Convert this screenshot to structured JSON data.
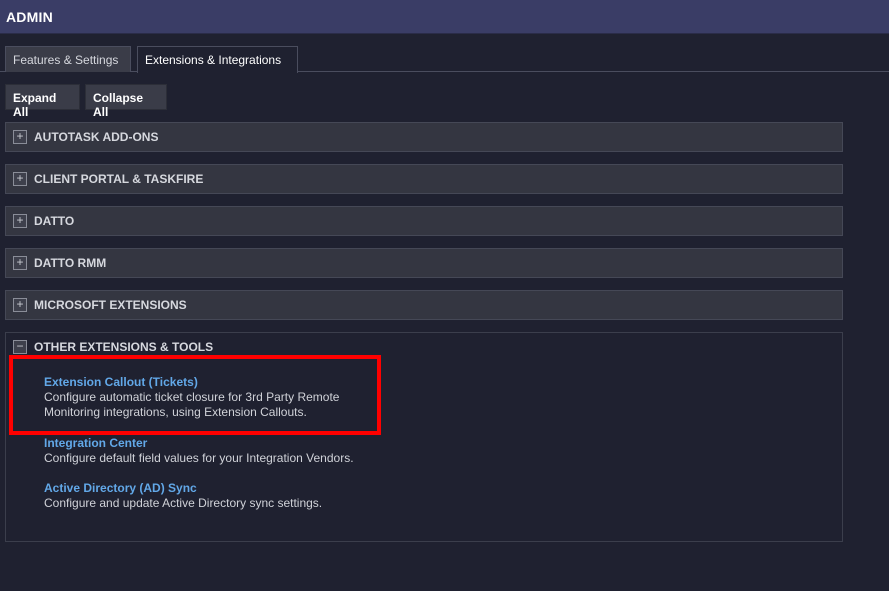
{
  "header": {
    "title": "ADMIN"
  },
  "tabs": [
    {
      "label": "Features & Settings",
      "active": false
    },
    {
      "label": "Extensions & Integrations",
      "active": true
    }
  ],
  "toolbar": {
    "expand_label": "Expand All",
    "collapse_label": "Collapse All"
  },
  "sections": [
    {
      "label": "AUTOTASK ADD-ONS",
      "toggle": "+"
    },
    {
      "label": "CLIENT PORTAL & TASKFIRE",
      "toggle": "+"
    },
    {
      "label": "DATTO",
      "toggle": "+"
    },
    {
      "label": "DATTO RMM",
      "toggle": "+"
    },
    {
      "label": "MICROSOFT EXTENSIONS",
      "toggle": "+"
    },
    {
      "label": "OTHER EXTENSIONS & TOOLS",
      "toggle": "−",
      "items": [
        {
          "title": "Extension Callout (Tickets)",
          "desc": "Configure automatic ticket closure for 3rd Party Remote Monitoring integrations, using Extension Callouts."
        },
        {
          "title": "Integration Center",
          "desc": "Configure default field values for your Integration Vendors."
        },
        {
          "title": "Active Directory (AD) Sync",
          "desc": "Configure and update Active Directory sync settings."
        }
      ]
    }
  ],
  "colors": {
    "accent_link": "#62a8e8",
    "header_bg": "#3a3d66",
    "highlight": "#ff0000"
  }
}
